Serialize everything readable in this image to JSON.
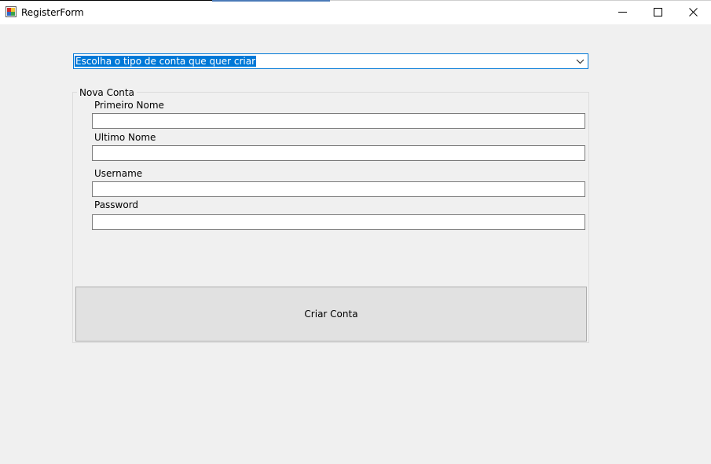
{
  "window": {
    "title": "RegisterForm",
    "minimize_glyph": "—",
    "maximize_glyph": "☐",
    "close_glyph": "✕"
  },
  "account_type": {
    "selected": "Escolha o tipo de conta que quer criar"
  },
  "group": {
    "title": "Nova Conta",
    "fields": [
      {
        "label": "Primeiro Nome",
        "value": ""
      },
      {
        "label": "Ultimo Nome",
        "value": ""
      },
      {
        "label": "Username",
        "value": ""
      },
      {
        "label": "Password",
        "value": ""
      }
    ],
    "submit_label": "Criar Conta"
  },
  "colors": {
    "accent": "#0078d7",
    "background": "#f0f0f0",
    "button": "#e1e1e1"
  },
  "icons": {
    "app": "app-form-icon",
    "dropdown": "chevron-down-icon",
    "minimize": "minimize-icon",
    "maximize": "maximize-icon",
    "close": "close-icon"
  }
}
